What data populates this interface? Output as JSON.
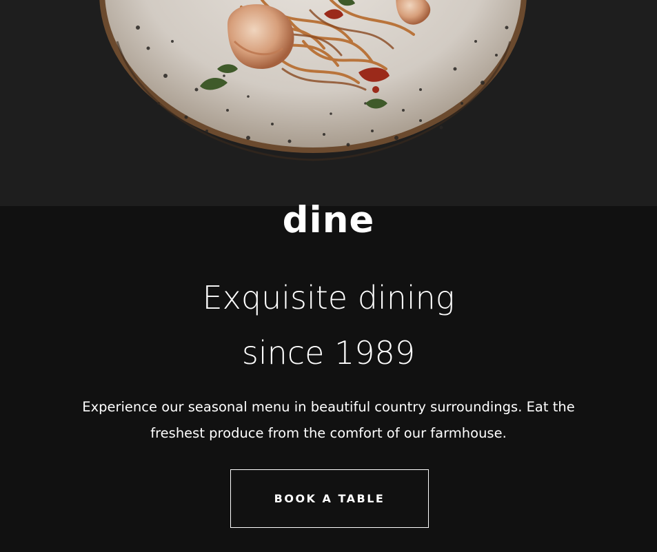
{
  "brand": {
    "logo_text": "dine"
  },
  "hero": {
    "image_subject": "seafood pasta with prawns on a speckled ceramic plate",
    "headline_line1": "Exquisite dining",
    "headline_line2": "since 1989",
    "lead_text": "Experience our seasonal menu in beautiful country surroundings. Eat the freshest produce from the comfort of our farmhouse.",
    "cta_label": "BOOK A TABLE"
  },
  "colors": {
    "page_background": "#111111",
    "image_background": "#1e1e1e",
    "text": "#ffffff",
    "button_border": "#ffffff"
  }
}
